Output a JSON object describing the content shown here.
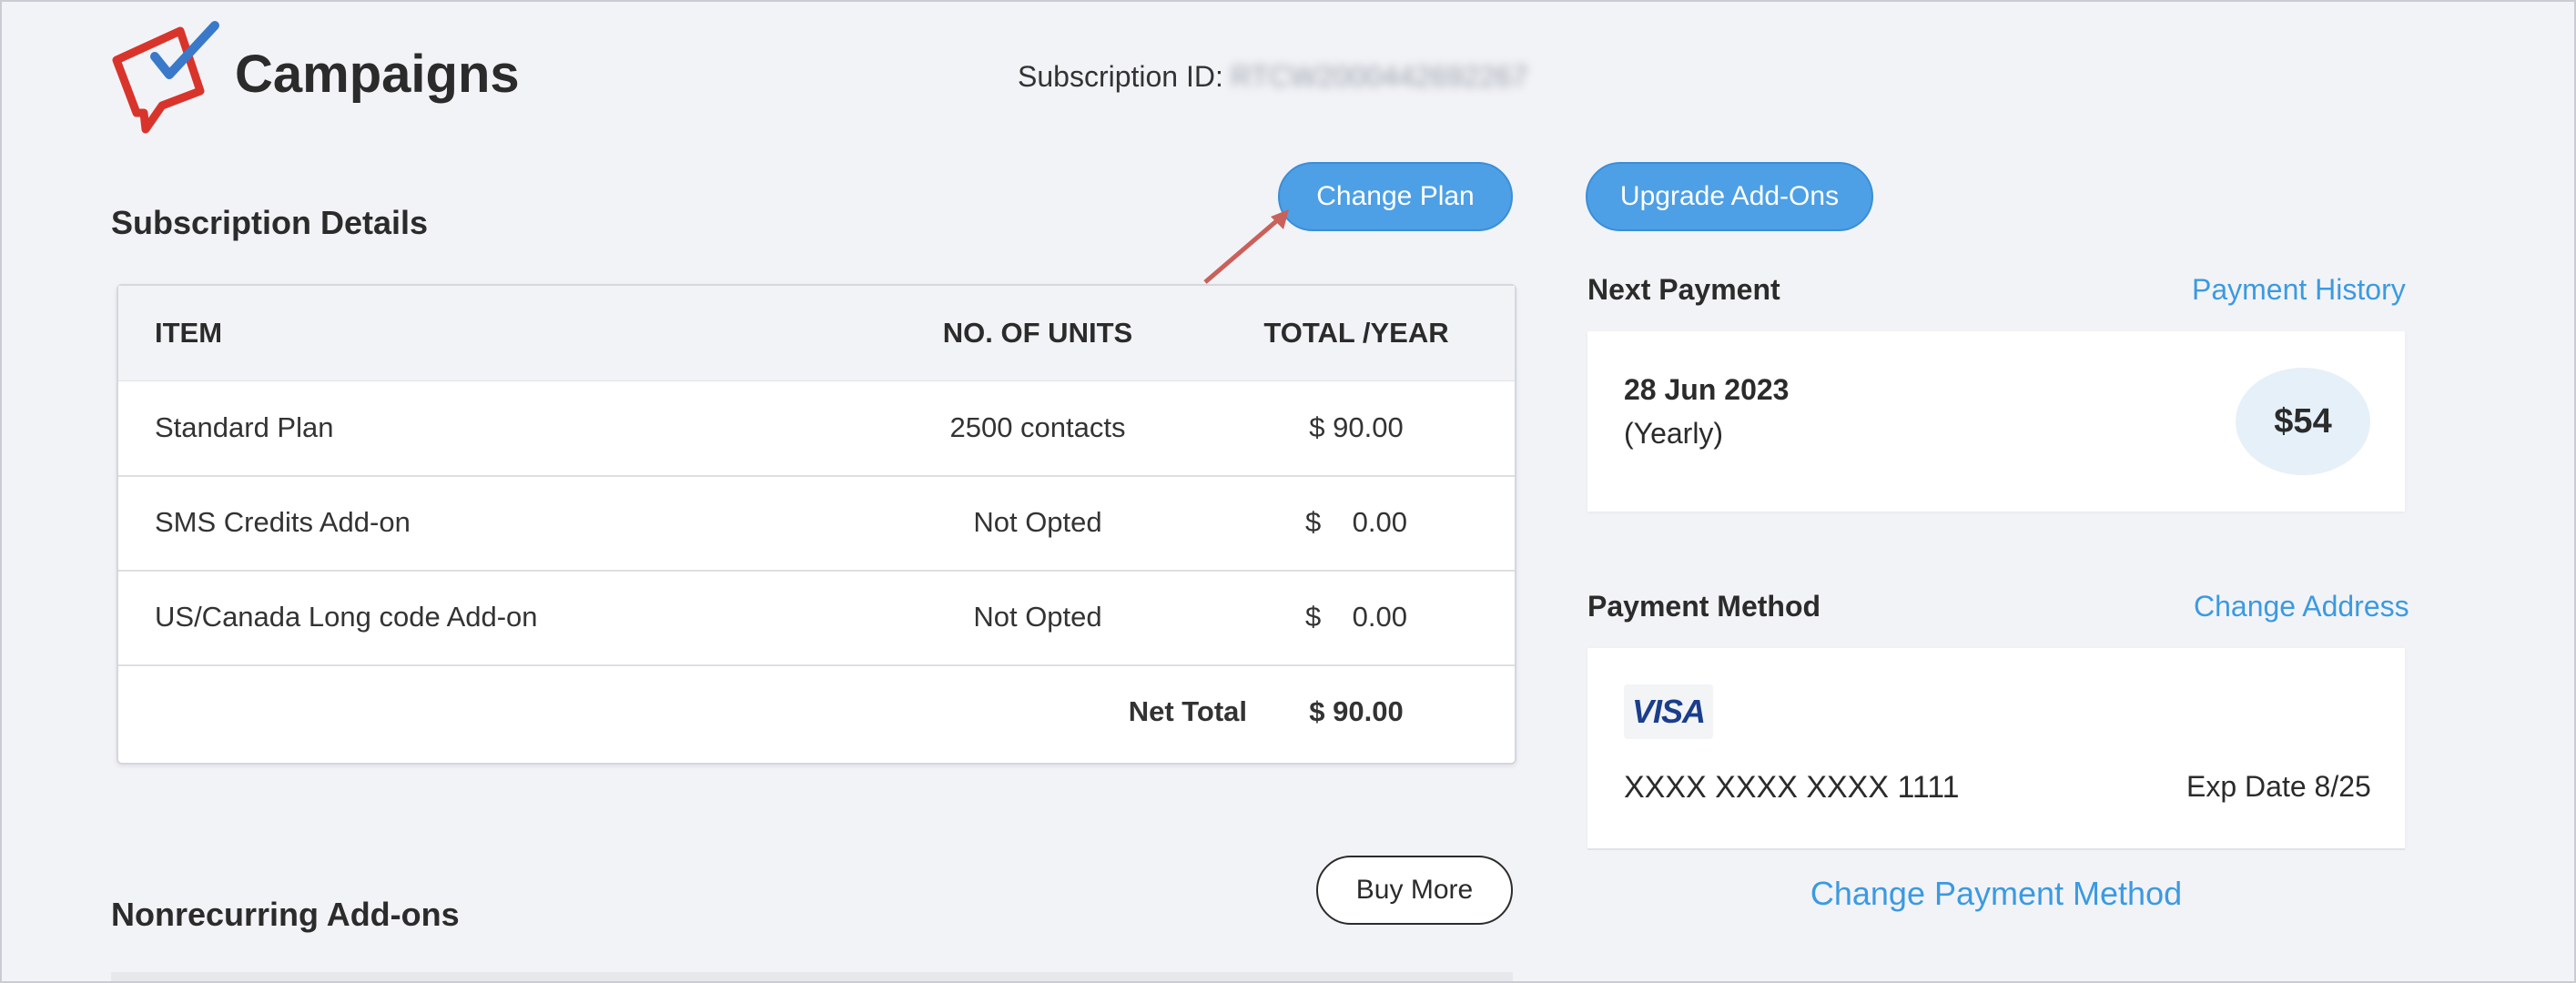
{
  "app": {
    "title": "Campaigns",
    "logo_icon": "campaigns-logo-icon"
  },
  "subscription": {
    "id_label": "Subscription ID:",
    "id_value": "RTCW2000442692267"
  },
  "buttons": {
    "change_plan": "Change Plan",
    "upgrade_addons": "Upgrade Add-Ons",
    "buy_more": "Buy More"
  },
  "subscription_details": {
    "title": "Subscription Details",
    "columns": [
      "ITEM",
      "NO. OF UNITS",
      "TOTAL /YEAR"
    ],
    "rows": [
      {
        "item": "Standard Plan",
        "units": "2500 contacts",
        "total": "$ 90.00"
      },
      {
        "item": "SMS Credits Add-on",
        "units": "Not Opted",
        "total": "$    0.00"
      },
      {
        "item": "US/Canada Long code Add-on",
        "units": "Not Opted",
        "total": "$    0.00"
      }
    ],
    "net_total_label": "Net Total",
    "net_total_value": "$ 90.00"
  },
  "nonrecurring": {
    "title": "Nonrecurring Add-ons"
  },
  "next_payment": {
    "title": "Next Payment",
    "history_link": "Payment History",
    "date": "28 Jun 2023",
    "period": "(Yearly)",
    "amount": "$54"
  },
  "payment_method": {
    "title": "Payment Method",
    "change_address_link": "Change Address",
    "card_brand": "VISA",
    "card_number": "XXXX XXXX XXXX 1111",
    "exp": "Exp Date 8/25",
    "change_method_link": "Change Payment Method"
  },
  "colors": {
    "accent": "#4da0e6",
    "link": "#3b9ae1",
    "logo_red": "#d9342b",
    "logo_blue": "#3a79c9"
  }
}
